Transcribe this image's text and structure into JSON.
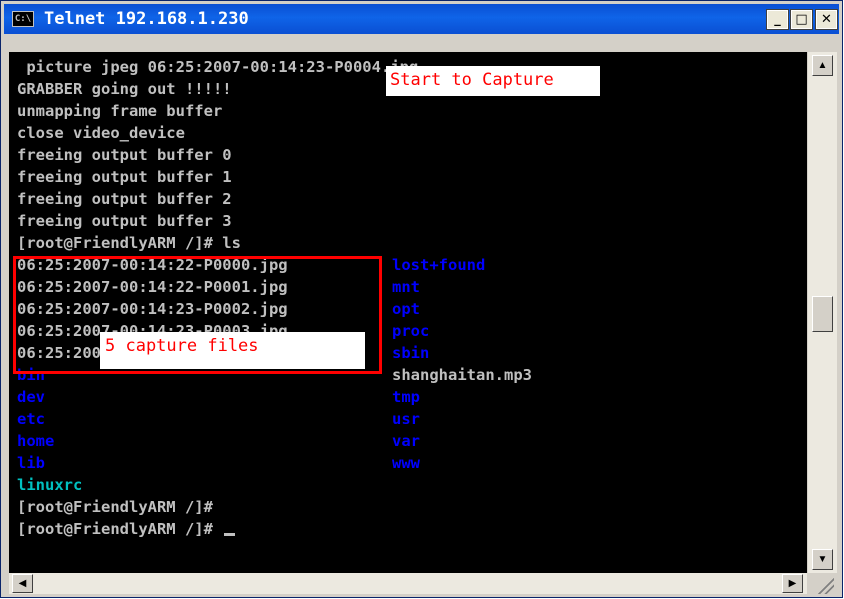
{
  "window": {
    "title": "Telnet 192.168.1.230",
    "icon_text": "C:\\"
  },
  "titlebar_buttons": {
    "minimize": "_",
    "maximize": "□",
    "close": "✕"
  },
  "console": {
    "lines": [
      " picture jpeg 06:25:2007-00:14:23-P0004.jpg",
      "GRABBER going out !!!!!",
      "unmapping frame buffer",
      "close video_device",
      "freeing output buffer 0",
      "freeing output buffer 1",
      "freeing output buffer 2",
      "freeing output buffer 3",
      "[root@FriendlyARM /]# ls"
    ],
    "files": [
      "06:25:2007-00:14:22-P0000.jpg",
      "06:25:2007-00:14:22-P0001.jpg",
      "06:25:2007-00:14:23-P0002.jpg",
      "06:25:2007-00:14:23-P0003.jpg",
      "06:25:2007-00:14:23-P0004.jpg"
    ],
    "col1_dirs": [
      "bin",
      "dev",
      "etc",
      "home",
      "lib"
    ],
    "col1_exe": "linuxrc",
    "col2_dirs_top": [
      "lost+found",
      "mnt",
      "opt",
      "proc",
      "sbin"
    ],
    "col2_file": "shanghaitan.mp3",
    "col2_dirs_bottom": [
      "tmp",
      "usr",
      "var",
      "www"
    ],
    "prompt_1": "[root@FriendlyARM /]#",
    "prompt_2": "[root@FriendlyARM /]# "
  },
  "annotations": {
    "start_capture": "Start to Capture",
    "five_files": "5 capture files"
  },
  "colors": {
    "console_bg": "#000000",
    "console_text": "#c0c0c0",
    "directory": "#0000ff",
    "executable": "#00c0c0",
    "annotation_red": "#ff0000",
    "titlebar_blue": "#0a4fd3"
  },
  "scrollbar": {
    "up": "▲",
    "down": "▼",
    "left": "◀",
    "right": "▶"
  }
}
